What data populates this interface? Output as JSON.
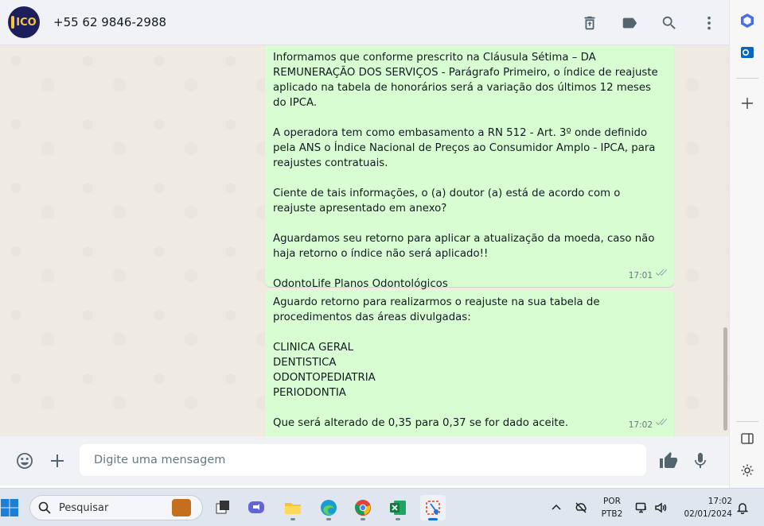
{
  "chat": {
    "contact_name": "+55 62 9846-2988",
    "avatar_text": "ICO",
    "header_icons": [
      "archive-icon",
      "label-icon",
      "search-icon",
      "menu-icon"
    ]
  },
  "messages": [
    {
      "text": "Informamos que conforme prescrito na Cláusula Sétima – DA REMUNERAÇÃO DOS SERVIÇOS - Parágrafo Primeiro, o índice de reajuste aplicado na tabela de honorários será a variação dos últimos 12 meses do IPCA.\n\nA operadora tem como embasamento a RN 512 - Art. 3º onde definido pela ANS o Índice Nacional de Preços ao Consumidor Amplo - IPCA, para reajustes contratuais.\n\nCiente de tais informações, o (a) doutor (a) está de acordo com o reajuste apresentado em anexo?\n\nAguardamos seu retorno para aplicar a atualização da moeda, caso não haja retorno o índice não será aplicado!!\n\nOdontoLife Planos Odontológicos",
      "time": "17:01"
    },
    {
      "text": "Aguardo retorno para realizarmos o reajuste na sua tabela de procedimentos das áreas divulgadas:\n\nCLINICA GERAL\nDENTISTICA\nODONTOPEDIATRIA\nPERIODONTIA\n\nQue será alterado de 0,35 para 0,37 se for dado aceite.",
      "time": "17:02"
    }
  ],
  "composer": {
    "placeholder": "Digite uma mensagem"
  },
  "taskbar": {
    "search_label": "Pesquisar",
    "language_line1": "POR",
    "language_line2": "PTB2",
    "time": "17:02",
    "date": "02/01/2024"
  }
}
